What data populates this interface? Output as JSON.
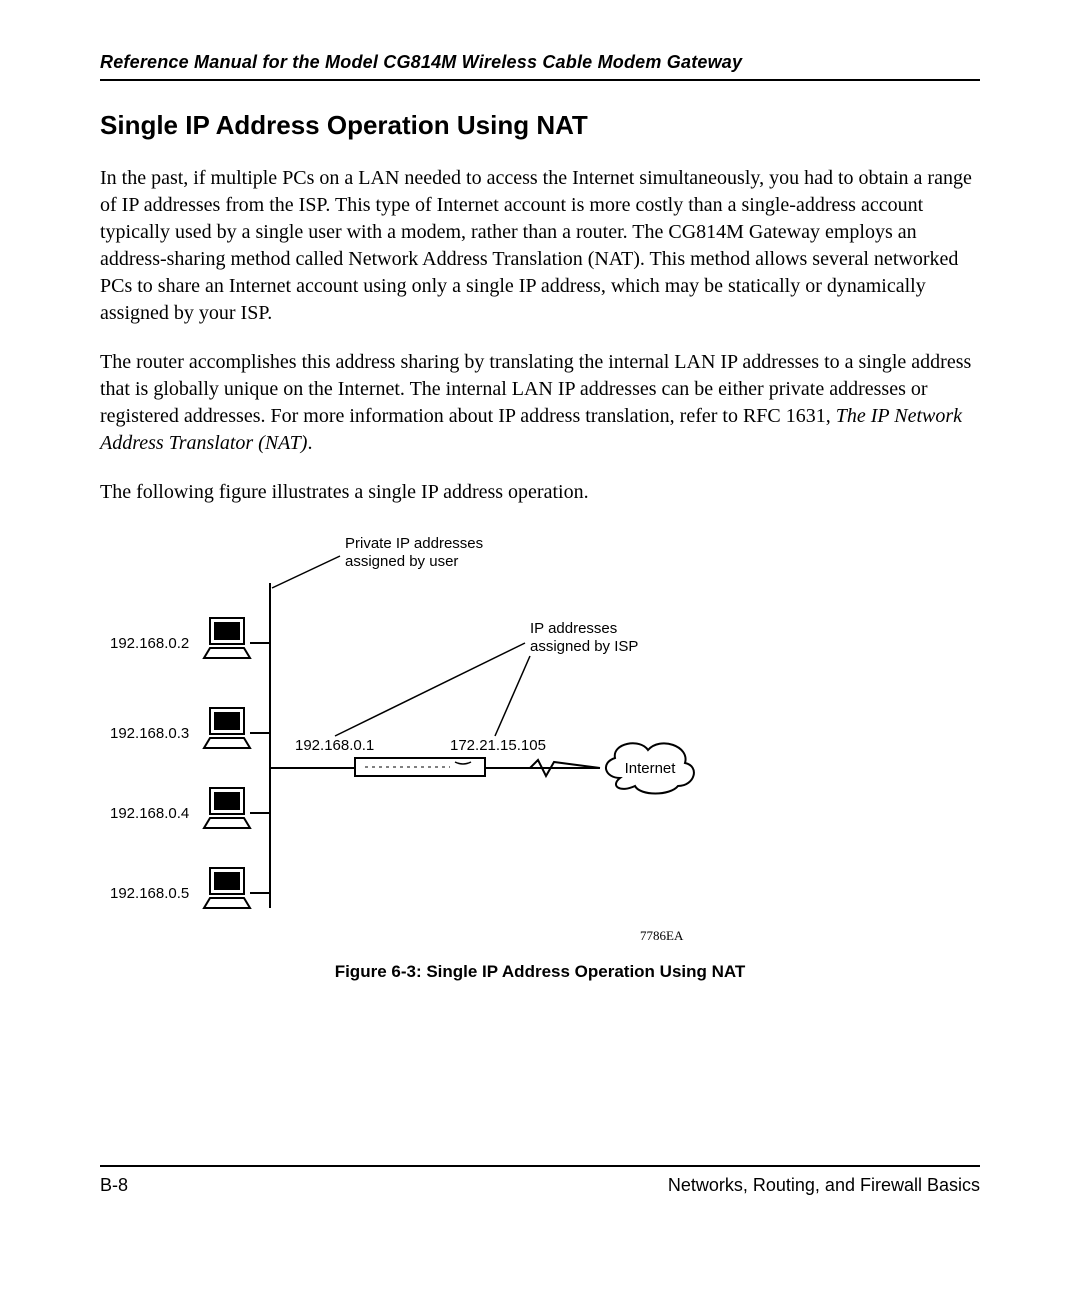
{
  "header": {
    "running_title": "Reference Manual for the Model CG814M Wireless Cable Modem Gateway"
  },
  "section": {
    "heading": "Single IP Address Operation Using NAT",
    "para1_a": "In the past, if multiple PCs on a LAN needed to access the Internet simultaneously, you had to obtain a range of IP addresses from the ISP. This type of Internet account is more costly than a single-address account typically used by a single user with a modem, rather than a router. The CG814M Gateway employs an address-sharing method called Network Address Translation (NAT). This method allows several networked PCs to share an Internet account using only a single IP address, which may be statically or dynamically assigned by your ISP.",
    "para2_a": "The router accomplishes this address sharing by translating the internal LAN IP addresses to a single address that is globally unique on the Internet. The internal LAN IP addresses can be either private addresses or registered addresses. For more information about IP address translation, refer to RFC 1631, ",
    "para2_ital": "The IP Network Address Translator (NAT)",
    "para2_b": ".",
    "para3": "The following figure illustrates a single IP address operation."
  },
  "figure": {
    "label_private": "Private IP addresses assigned by user",
    "label_isp": "IP addresses assigned by ISP",
    "pc_ips": [
      "192.168.0.2",
      "192.168.0.3",
      "192.168.0.4",
      "192.168.0.5"
    ],
    "router_lan_ip": "192.168.0.1",
    "router_wan_ip": "172.21.15.105",
    "cloud_label": "Internet",
    "code": "7786EA",
    "caption": "Figure 6-3: Single IP Address Operation Using NAT"
  },
  "footer": {
    "page_number": "B-8",
    "section_title": "Networks, Routing, and Firewall Basics"
  }
}
